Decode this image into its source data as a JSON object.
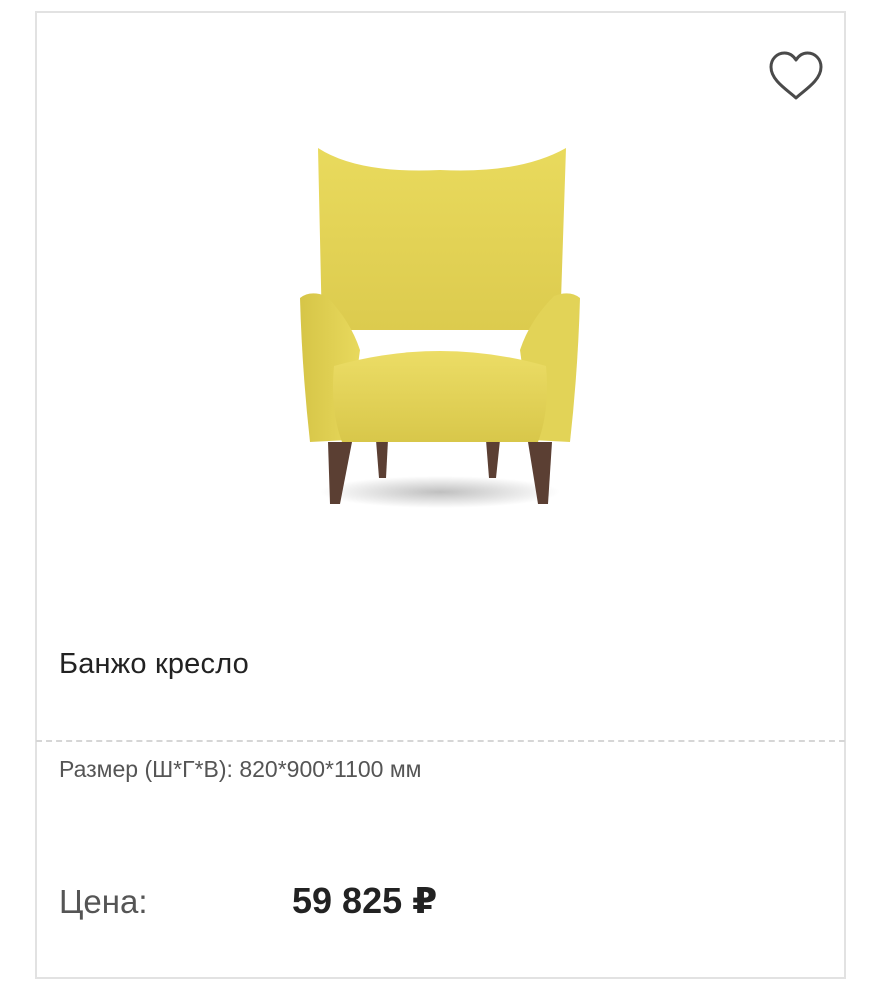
{
  "product": {
    "title": "Банжо кресло",
    "image_icon": "armchair-icon",
    "favorite_icon": "heart-icon",
    "spec": {
      "label": "Размер (Ш*Г*В):",
      "value": "820*900*1100 мм"
    },
    "price": {
      "label": "Цена:",
      "value": "59 825 ₽"
    }
  },
  "colors": {
    "upholstery": "#e6d65a",
    "legs": "#5b3f33",
    "card_border": "#e2e2e2",
    "title_text": "#222222",
    "secondary_text": "#555555"
  }
}
